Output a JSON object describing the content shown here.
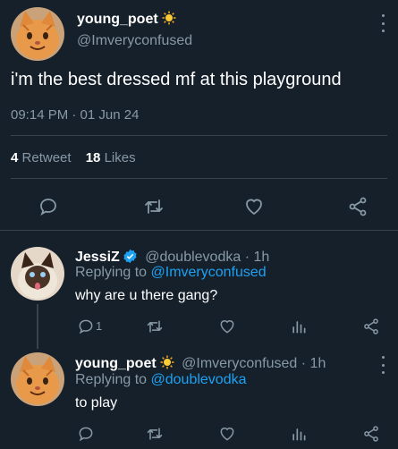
{
  "colors": {
    "background": "#15202b",
    "text": "#ffffff",
    "muted": "#8899a6",
    "accent": "#1da1f2",
    "divider": "#38444d"
  },
  "main_tweet": {
    "display_name": "young_poet",
    "handle": "@Imveryconfused",
    "badge_icon": "sun-emoji",
    "text": "i'm the best dressed mf at this playground",
    "timestamp": "09:14 PM · 01 Jun 24",
    "retweet_count": "4",
    "retweet_label": "Retweet",
    "like_count": "18",
    "like_label": "Likes",
    "actions": [
      "reply-icon",
      "retweet-icon",
      "like-icon",
      "share-icon"
    ]
  },
  "replies": [
    {
      "display_name": "JessiZ",
      "badge_icon": "verified-badge",
      "handle": "@doublevodka",
      "time": "· 1h",
      "replying_prefix": "Replying to",
      "replying_to": "@Imveryconfused",
      "text": "why are u there gang?",
      "reply_count": "1",
      "actions": [
        "reply-icon",
        "retweet-icon",
        "like-icon",
        "analytics-icon",
        "share-icon"
      ]
    },
    {
      "display_name": "young_poet",
      "badge_icon": "sun-emoji",
      "handle": "@Imveryconfused",
      "time": "· 1h",
      "replying_prefix": "Replying to",
      "replying_to": "@doublevodka",
      "text": "to play",
      "actions": [
        "reply-icon",
        "retweet-icon",
        "like-icon",
        "analytics-icon",
        "share-icon"
      ]
    }
  ]
}
